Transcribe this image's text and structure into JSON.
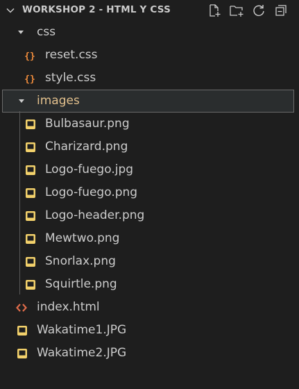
{
  "explorer": {
    "title": "WORKSHOP 2 - HTML Y CSS",
    "actions": [
      {
        "icon": "new-file-icon"
      },
      {
        "icon": "new-folder-icon"
      },
      {
        "icon": "refresh-icon"
      },
      {
        "icon": "collapse-all-icon"
      }
    ]
  },
  "tree": [
    {
      "label": "css",
      "type": "folder",
      "icon": "chevron-down-icon"
    },
    {
      "label": "reset.css",
      "type": "file",
      "icon": "css-file-icon"
    },
    {
      "label": "style.css",
      "type": "file",
      "icon": "css-file-icon"
    },
    {
      "label": "images",
      "type": "folder",
      "icon": "chevron-down-icon",
      "selected": true
    },
    {
      "label": "Bulbasaur.png",
      "type": "file",
      "icon": "image-file-icon"
    },
    {
      "label": "Charizard.png",
      "type": "file",
      "icon": "image-file-icon"
    },
    {
      "label": "Logo-fuego.jpg",
      "type": "file",
      "icon": "image-file-icon"
    },
    {
      "label": "Logo-fuego.png",
      "type": "file",
      "icon": "image-file-icon"
    },
    {
      "label": "Logo-header.png",
      "type": "file",
      "icon": "image-file-icon"
    },
    {
      "label": "Mewtwo.png",
      "type": "file",
      "icon": "image-file-icon"
    },
    {
      "label": "Snorlax.png",
      "type": "file",
      "icon": "image-file-icon"
    },
    {
      "label": "Squirtle.png",
      "type": "file",
      "icon": "image-file-icon"
    },
    {
      "label": "index.html",
      "type": "file",
      "icon": "html-file-icon"
    },
    {
      "label": "Wakatime1.JPG",
      "type": "file",
      "icon": "image-file-icon"
    },
    {
      "label": "Wakatime2.JPG",
      "type": "file",
      "icon": "image-file-icon"
    }
  ],
  "colors": {
    "background": "#1e1e1e",
    "text": "#cccccc",
    "selected_folder_text": "#e2c08d",
    "css_icon": "#f08c3c",
    "image_icon": "#f3d16b",
    "html_icon": "#e06c4a"
  }
}
